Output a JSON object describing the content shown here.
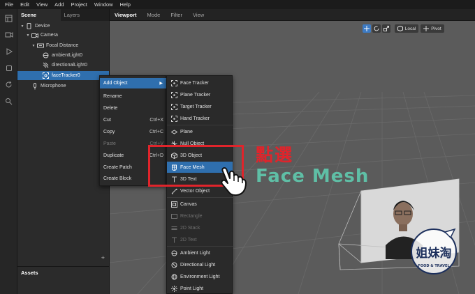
{
  "menubar": {
    "items": [
      "File",
      "Edit",
      "View",
      "Add",
      "Project",
      "Window",
      "Help"
    ]
  },
  "toolbar": {
    "icons": [
      "layout-icon",
      "camera-icon",
      "play-icon",
      "square-icon",
      "refresh-icon",
      "search-icon"
    ]
  },
  "scene_panel": {
    "tabs": [
      {
        "label": "Scene",
        "active": true
      },
      {
        "label": "Layers",
        "active": false
      }
    ],
    "tree": [
      {
        "label": "Device",
        "icon": "device-icon",
        "depth": 0
      },
      {
        "label": "Camera",
        "icon": "camera-icon",
        "depth": 1
      },
      {
        "label": "Focal Distance",
        "icon": "focal-distance-icon",
        "depth": 2
      },
      {
        "label": "ambientLight0",
        "icon": "ambient-light-icon",
        "depth": 3
      },
      {
        "label": "directionalLight0",
        "icon": "directional-light-icon",
        "depth": 3
      },
      {
        "label": "faceTracker0",
        "icon": "face-tracker-icon",
        "depth": 3,
        "selected": true
      },
      {
        "label": "Microphone",
        "icon": "microphone-icon",
        "depth": 1
      }
    ],
    "add_button": "+"
  },
  "assets_panel": {
    "title": "Assets"
  },
  "viewport": {
    "tabs": [
      "Viewport",
      "Mode",
      "Filter",
      "View"
    ],
    "local_label": "Local",
    "pivot_label": "Pivot"
  },
  "context_menu": {
    "items": [
      {
        "label": "Add Object",
        "shortcut": "",
        "highlighted": true,
        "submenu": true
      },
      {
        "label": "Rename",
        "shortcut": ""
      },
      {
        "label": "Delete",
        "shortcut": ""
      },
      {
        "label": "Cut",
        "shortcut": "Ctrl+X"
      },
      {
        "label": "Copy",
        "shortcut": "Ctrl+C"
      },
      {
        "label": "Paste",
        "shortcut": "Ctrl+V",
        "disabled": true
      },
      {
        "label": "Duplicate",
        "shortcut": "Ctrl+D"
      },
      {
        "label": "Create Patch",
        "shortcut": ""
      },
      {
        "label": "Create Block",
        "shortcut": ""
      }
    ]
  },
  "add_object_menu": {
    "items": [
      {
        "label": "Face Tracker",
        "icon": "tracker-icon"
      },
      {
        "label": "Plane Tracker",
        "icon": "tracker-icon"
      },
      {
        "label": "Target Tracker",
        "icon": "tracker-icon"
      },
      {
        "label": "Hand Tracker",
        "icon": "tracker-icon"
      },
      {
        "label": "Plane",
        "icon": "plane-icon"
      },
      {
        "label": "Null Object",
        "icon": "null-object-icon"
      },
      {
        "label": "3D Object",
        "icon": "cube-icon"
      },
      {
        "label": "Face Mesh",
        "icon": "face-mesh-icon",
        "highlighted": true
      },
      {
        "label": "3D Text",
        "icon": "text-icon"
      },
      {
        "label": "Vector Object",
        "icon": "vector-icon"
      },
      {
        "label": "Canvas",
        "icon": "canvas-icon"
      },
      {
        "label": "Rectangle",
        "icon": "rectangle-icon",
        "disabled": true
      },
      {
        "label": "2D Stack",
        "icon": "stack-icon",
        "disabled": true
      },
      {
        "label": "2D Text",
        "icon": "text-icon",
        "disabled": true
      },
      {
        "label": "Ambient Light",
        "icon": "ambient-light-icon"
      },
      {
        "label": "Directional Light",
        "icon": "directional-light-icon"
      },
      {
        "label": "Environment Light",
        "icon": "environment-light-icon"
      },
      {
        "label": "Point Light",
        "icon": "point-light-icon"
      }
    ]
  },
  "annotation": {
    "line1": "點選",
    "line2": "Face Mesh",
    "colors": {
      "red": "#e0242b",
      "teal": "#5fbfa6"
    }
  },
  "watermark": {
    "title": "姐妹淘",
    "subtitle": "FOOD & TRAVEL"
  },
  "colors": {
    "accent": "#2f6fae",
    "viewport_bg": "#5b5b5b"
  }
}
